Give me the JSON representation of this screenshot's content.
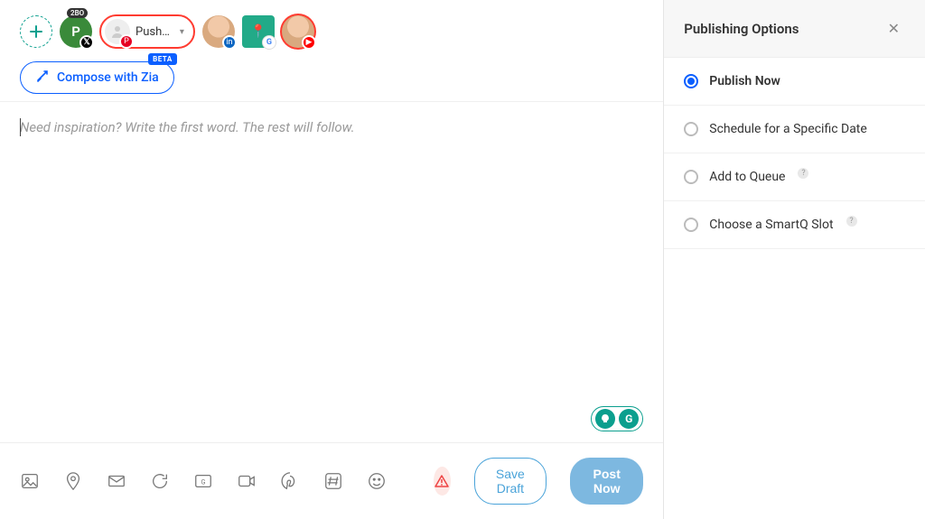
{
  "topbar": {
    "add_tooltip": "Add account",
    "avatar_p_letter": "P",
    "avatar_p_badge": "2BO",
    "pill_label": "Push…"
  },
  "compose": {
    "zia_label": "Compose with Zia",
    "zia_badge": "BETA",
    "placeholder": "Need inspiration? Write the first word. The rest will follow."
  },
  "sidebar": {
    "title": "Publishing Options",
    "options": [
      {
        "label": "Publish Now",
        "selected": true
      },
      {
        "label": "Schedule for a Specific Date",
        "selected": false
      },
      {
        "label": "Add to Queue",
        "selected": false,
        "info": true
      },
      {
        "label": "Choose a SmartQ Slot",
        "selected": false,
        "info": true
      }
    ]
  },
  "bottom": {
    "save_draft": "Save Draft",
    "post_now": "Post Now"
  },
  "float": {
    "g_letter": "G"
  }
}
